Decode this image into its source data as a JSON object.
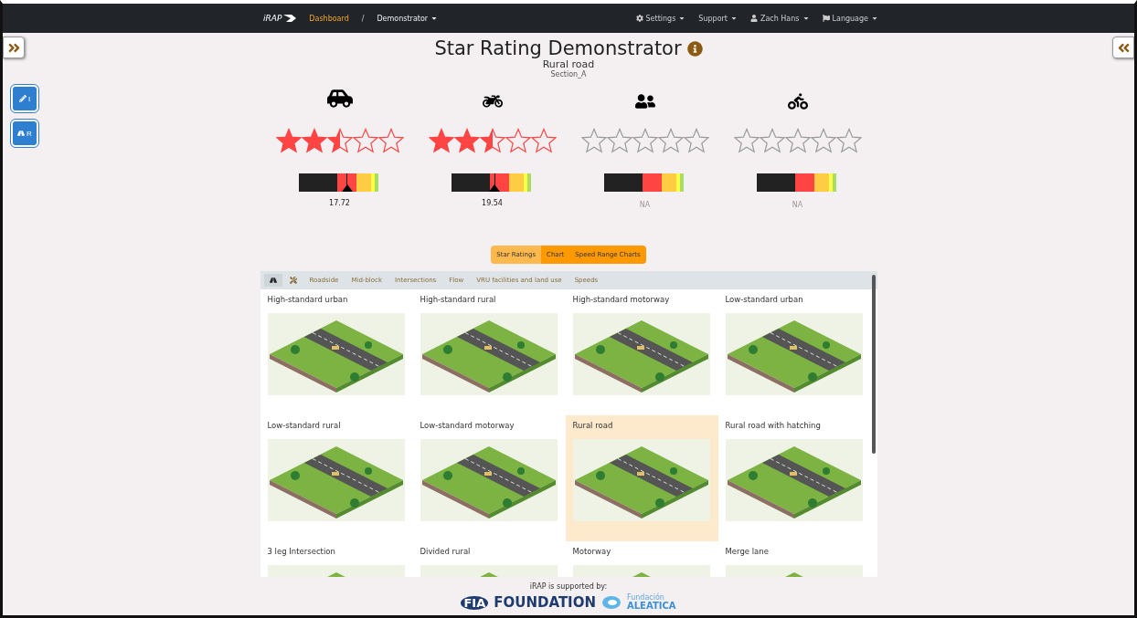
{
  "navbar": {
    "logo": "iRAP",
    "separator": "/",
    "breadcrumb": [
      {
        "label": "Dashboard",
        "kind": "link"
      },
      {
        "label": "Demonstrator",
        "kind": "menu"
      }
    ],
    "menus": [
      {
        "label": "Settings",
        "kind": "settings"
      },
      {
        "label": "Support",
        "kind": "plain"
      },
      {
        "label": "Zach Hans",
        "kind": "user"
      },
      {
        "label": "Language",
        "kind": "language"
      }
    ]
  },
  "side_buttons": [
    {
      "kind": "pencil",
      "label": "I"
    },
    {
      "kind": "road",
      "label": "R"
    }
  ],
  "header": {
    "title": "Star Rating Demonstrator",
    "subtitle": "Rural road",
    "section": "Section_A"
  },
  "road_users": [
    {
      "kind": "car",
      "stars": 2.5,
      "level": 0.59,
      "reading": "17.72"
    },
    {
      "kind": "motorcycle",
      "stars": 2.5,
      "level": 0.53,
      "reading": "19.54"
    },
    {
      "kind": "pedestrian",
      "stars": 0,
      "reading": "NA"
    },
    {
      "kind": "bicycle",
      "stars": 0,
      "reading": "NA"
    }
  ],
  "view_buttons": [
    {
      "label": "Star Ratings",
      "selected": true
    },
    {
      "label": "Chart",
      "selected": false
    },
    {
      "label": "Speed Range Charts",
      "selected": false
    }
  ],
  "tabs": [
    {
      "kind": "road",
      "selected": true
    },
    {
      "kind": "tools",
      "selected": false
    },
    {
      "kind": "text",
      "label": "Roadside",
      "selected": false
    },
    {
      "kind": "text",
      "label": "Mid-block",
      "selected": false
    },
    {
      "kind": "text",
      "label": "Intersections",
      "selected": false
    },
    {
      "kind": "text",
      "label": "Flow",
      "selected": false
    },
    {
      "kind": "text",
      "label": "VRU facilities and land use",
      "selected": false
    },
    {
      "kind": "text",
      "label": "Speeds",
      "selected": false
    }
  ],
  "scenarios": [
    {
      "title": "High-standard urban",
      "selected": false
    },
    {
      "title": "High-standard rural",
      "selected": false
    },
    {
      "title": "High-standard motorway",
      "selected": false
    },
    {
      "title": "Low-standard urban",
      "selected": false
    },
    {
      "title": "Low-standard rural",
      "selected": false
    },
    {
      "title": "Low-standard motorway",
      "selected": false
    },
    {
      "title": "Rural road",
      "selected": true
    },
    {
      "title": "Rural road with hatching",
      "selected": false
    },
    {
      "title": "3 leg Intersection",
      "selected": false
    },
    {
      "title": "Divided rural",
      "selected": false
    },
    {
      "title": "Motorway",
      "selected": false
    },
    {
      "title": "Merge lane",
      "selected": false
    }
  ],
  "footer": {
    "note": "iRAP is supported by:",
    "sponsors": [
      {
        "kind": "fia",
        "mark": "FIA",
        "name": "FOUNDATION"
      },
      {
        "kind": "aleatica",
        "mark": "Fundación",
        "name": "ALEATICA"
      }
    ]
  }
}
